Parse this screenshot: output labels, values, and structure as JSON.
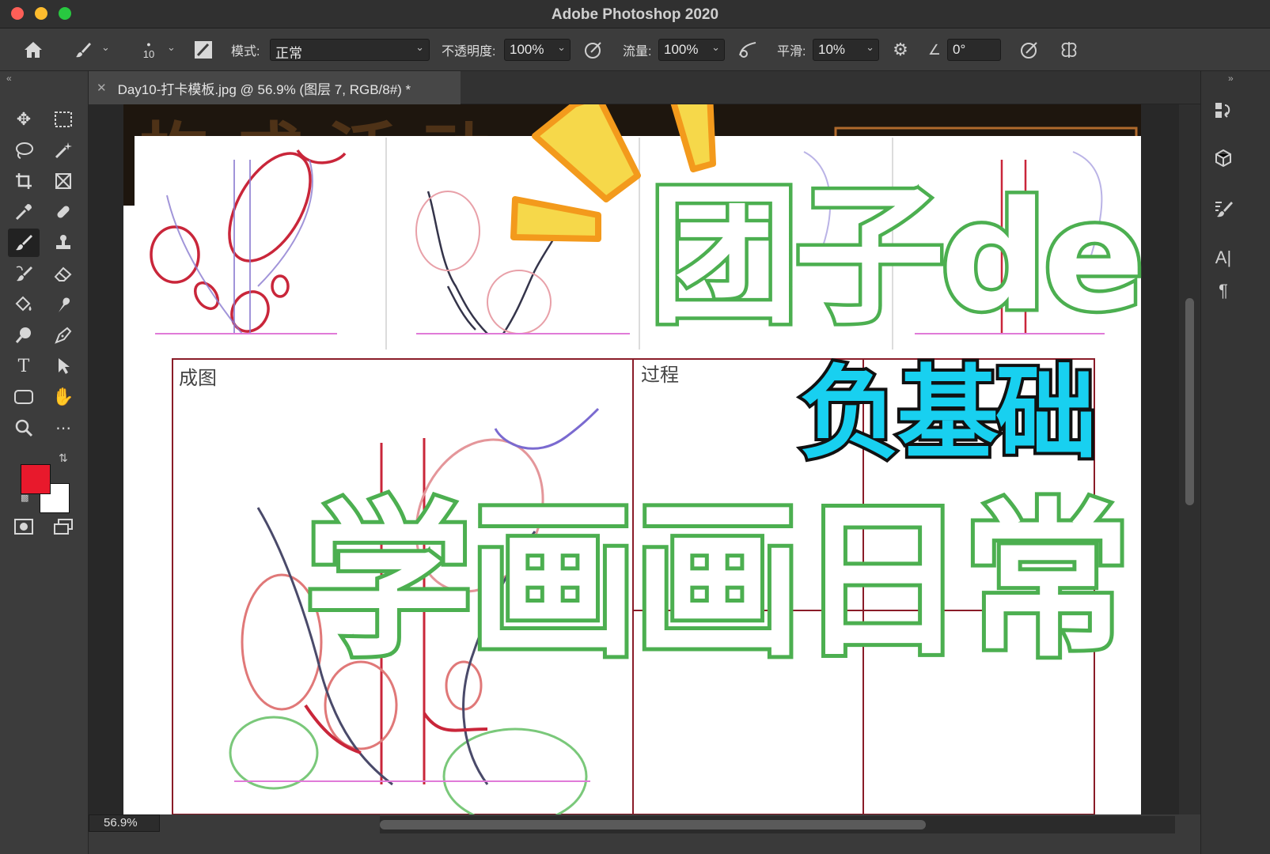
{
  "window": {
    "title": "Adobe Photoshop 2020"
  },
  "options_bar": {
    "brush_size": "10",
    "mode_label": "模式:",
    "mode_value": "正常",
    "opacity_label": "不透明度:",
    "opacity_value": "100%",
    "flow_label": "流量:",
    "flow_value": "100%",
    "smoothing_label": "平滑:",
    "smoothing_value": "10%",
    "angle_value": "0°"
  },
  "document": {
    "tab_title": "Day10-打卡模板.jpg @ 56.9% (图层 7, RGB/8#) *",
    "panel_label_result": "成图",
    "panel_label_process": "过程"
  },
  "overlay": {
    "line1": "团子de",
    "line2": "负基础",
    "line3": "学画画日常"
  },
  "status": {
    "zoom": "56.9%"
  },
  "colors": {
    "foreground": "#e8192c",
    "background": "#ffffff",
    "accent_green": "#4caf50",
    "accent_cyan": "#18d0f0"
  },
  "icons": {
    "toolbar": [
      "move-icon",
      "marquee-icon",
      "lasso-icon",
      "magic-wand-icon",
      "crop-icon",
      "frame-icon",
      "eyedropper-icon",
      "healing-brush-icon",
      "brush-icon",
      "clone-stamp-icon",
      "history-brush-icon",
      "eraser-icon",
      "paint-bucket-icon",
      "smudge-icon",
      "dodge-icon",
      "pen-icon",
      "type-icon",
      "path-select-icon",
      "shape-icon",
      "hand-icon",
      "zoom-icon",
      "more-icon"
    ]
  }
}
